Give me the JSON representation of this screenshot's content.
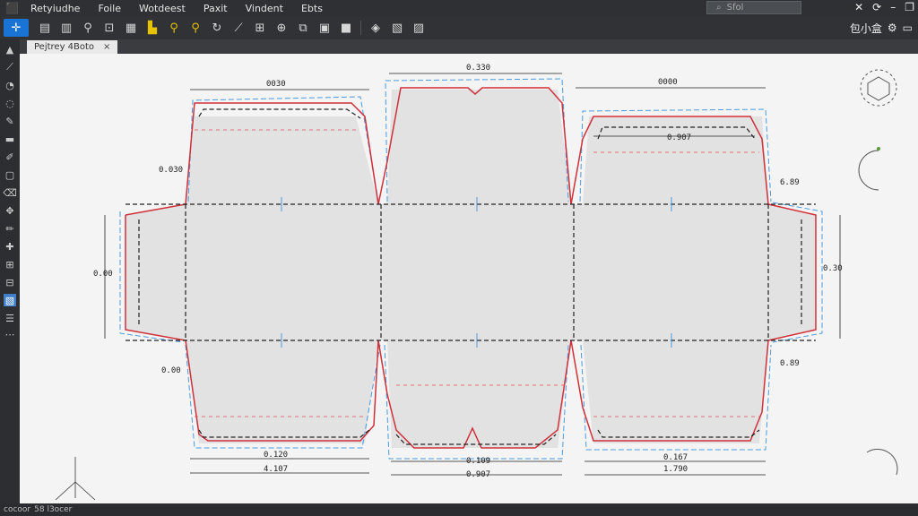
{
  "menubar": {
    "app_name": "Retyiudhe",
    "items": [
      "Foile",
      "Wotdeest",
      "Paxit",
      "Vindent",
      "Ebts"
    ]
  },
  "search": {
    "placeholder": "Sfol"
  },
  "toolbar": {
    "right_label": "包小盒"
  },
  "tab": {
    "label": "Pejtrey 4Boto",
    "close": "×"
  },
  "dims": {
    "top_left": "0030",
    "top_center": "0.330",
    "top_right": "0000",
    "right_inner": "0.907",
    "left_upper": "0.030",
    "left_mid": "0.00",
    "left_lower": "0.00",
    "right_upper": "6.89",
    "right_mid": "0.30",
    "right_lower": "0.89",
    "bottom_left_1": "0.120",
    "bottom_left_2": "4.107",
    "bottom_center_1": "0.109",
    "bottom_center_2": "0.907",
    "bottom_right_1": "0.167",
    "bottom_right_2": "1.790"
  },
  "status": {
    "left": "cocoor",
    "right": "58 l3ocer"
  },
  "colors": {
    "accent": "#1a74d6",
    "cut_line": "#d0303a",
    "fold_line": "#222222",
    "bleed_line": "#4a9be0"
  }
}
